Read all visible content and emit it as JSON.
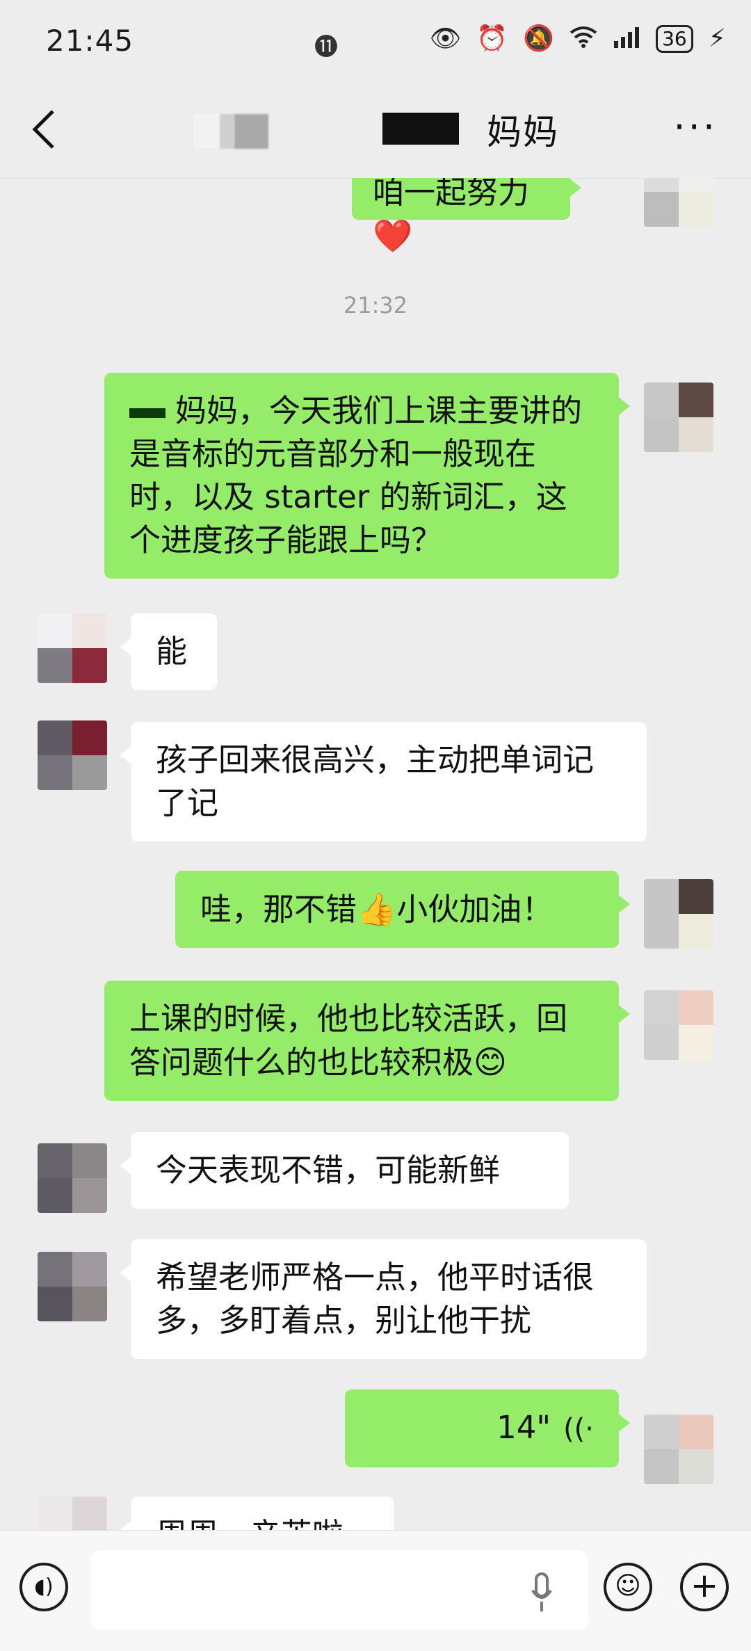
{
  "status_bar": {
    "time": "21:45",
    "icons": [
      "eye-icon",
      "alarm-icon",
      "mute-icon",
      "wifi-icon",
      "signal-icon"
    ],
    "battery": "36"
  },
  "nav": {
    "title": "妈妈",
    "back_icon": "chevron-left-icon",
    "more_icon": "more-dots-icon"
  },
  "messages": [
    {
      "side": "out",
      "text": "咱一起努力",
      "emoji": "❤️"
    },
    {
      "type": "timestamp",
      "text": "21:32"
    },
    {
      "side": "out",
      "text": "妈妈，今天我们上课主要讲的是音标的元音部分和一般现在时，以及 starter 的新词汇，这个进度孩子能跟上吗？"
    },
    {
      "side": "in",
      "text": "能"
    },
    {
      "side": "in",
      "text": "孩子回来很高兴，主动把单词记了记"
    },
    {
      "side": "out",
      "text_a": "哇，那不错",
      "emoji": "👍",
      "text_b": "小伙加油！"
    },
    {
      "side": "out",
      "text": "上课的时候，他也比较活跃，回答问题什么的也比较积极",
      "emoji": "😊"
    },
    {
      "side": "in",
      "text": "今天表现不错，可能新鲜"
    },
    {
      "side": "in",
      "text": "希望老师严格一点，他平时话很多，多盯着点，别让他干扰"
    },
    {
      "side": "out",
      "type": "voice",
      "duration": "14\""
    },
    {
      "side": "in",
      "text": "周周，辛苦啦"
    }
  ],
  "input_bar": {
    "voice_icon": "voice-mode-icon",
    "mic_icon": "microphone-icon",
    "emoji_icon": "emoji-icon",
    "plus_icon": "plus-icon",
    "placeholder": ""
  }
}
